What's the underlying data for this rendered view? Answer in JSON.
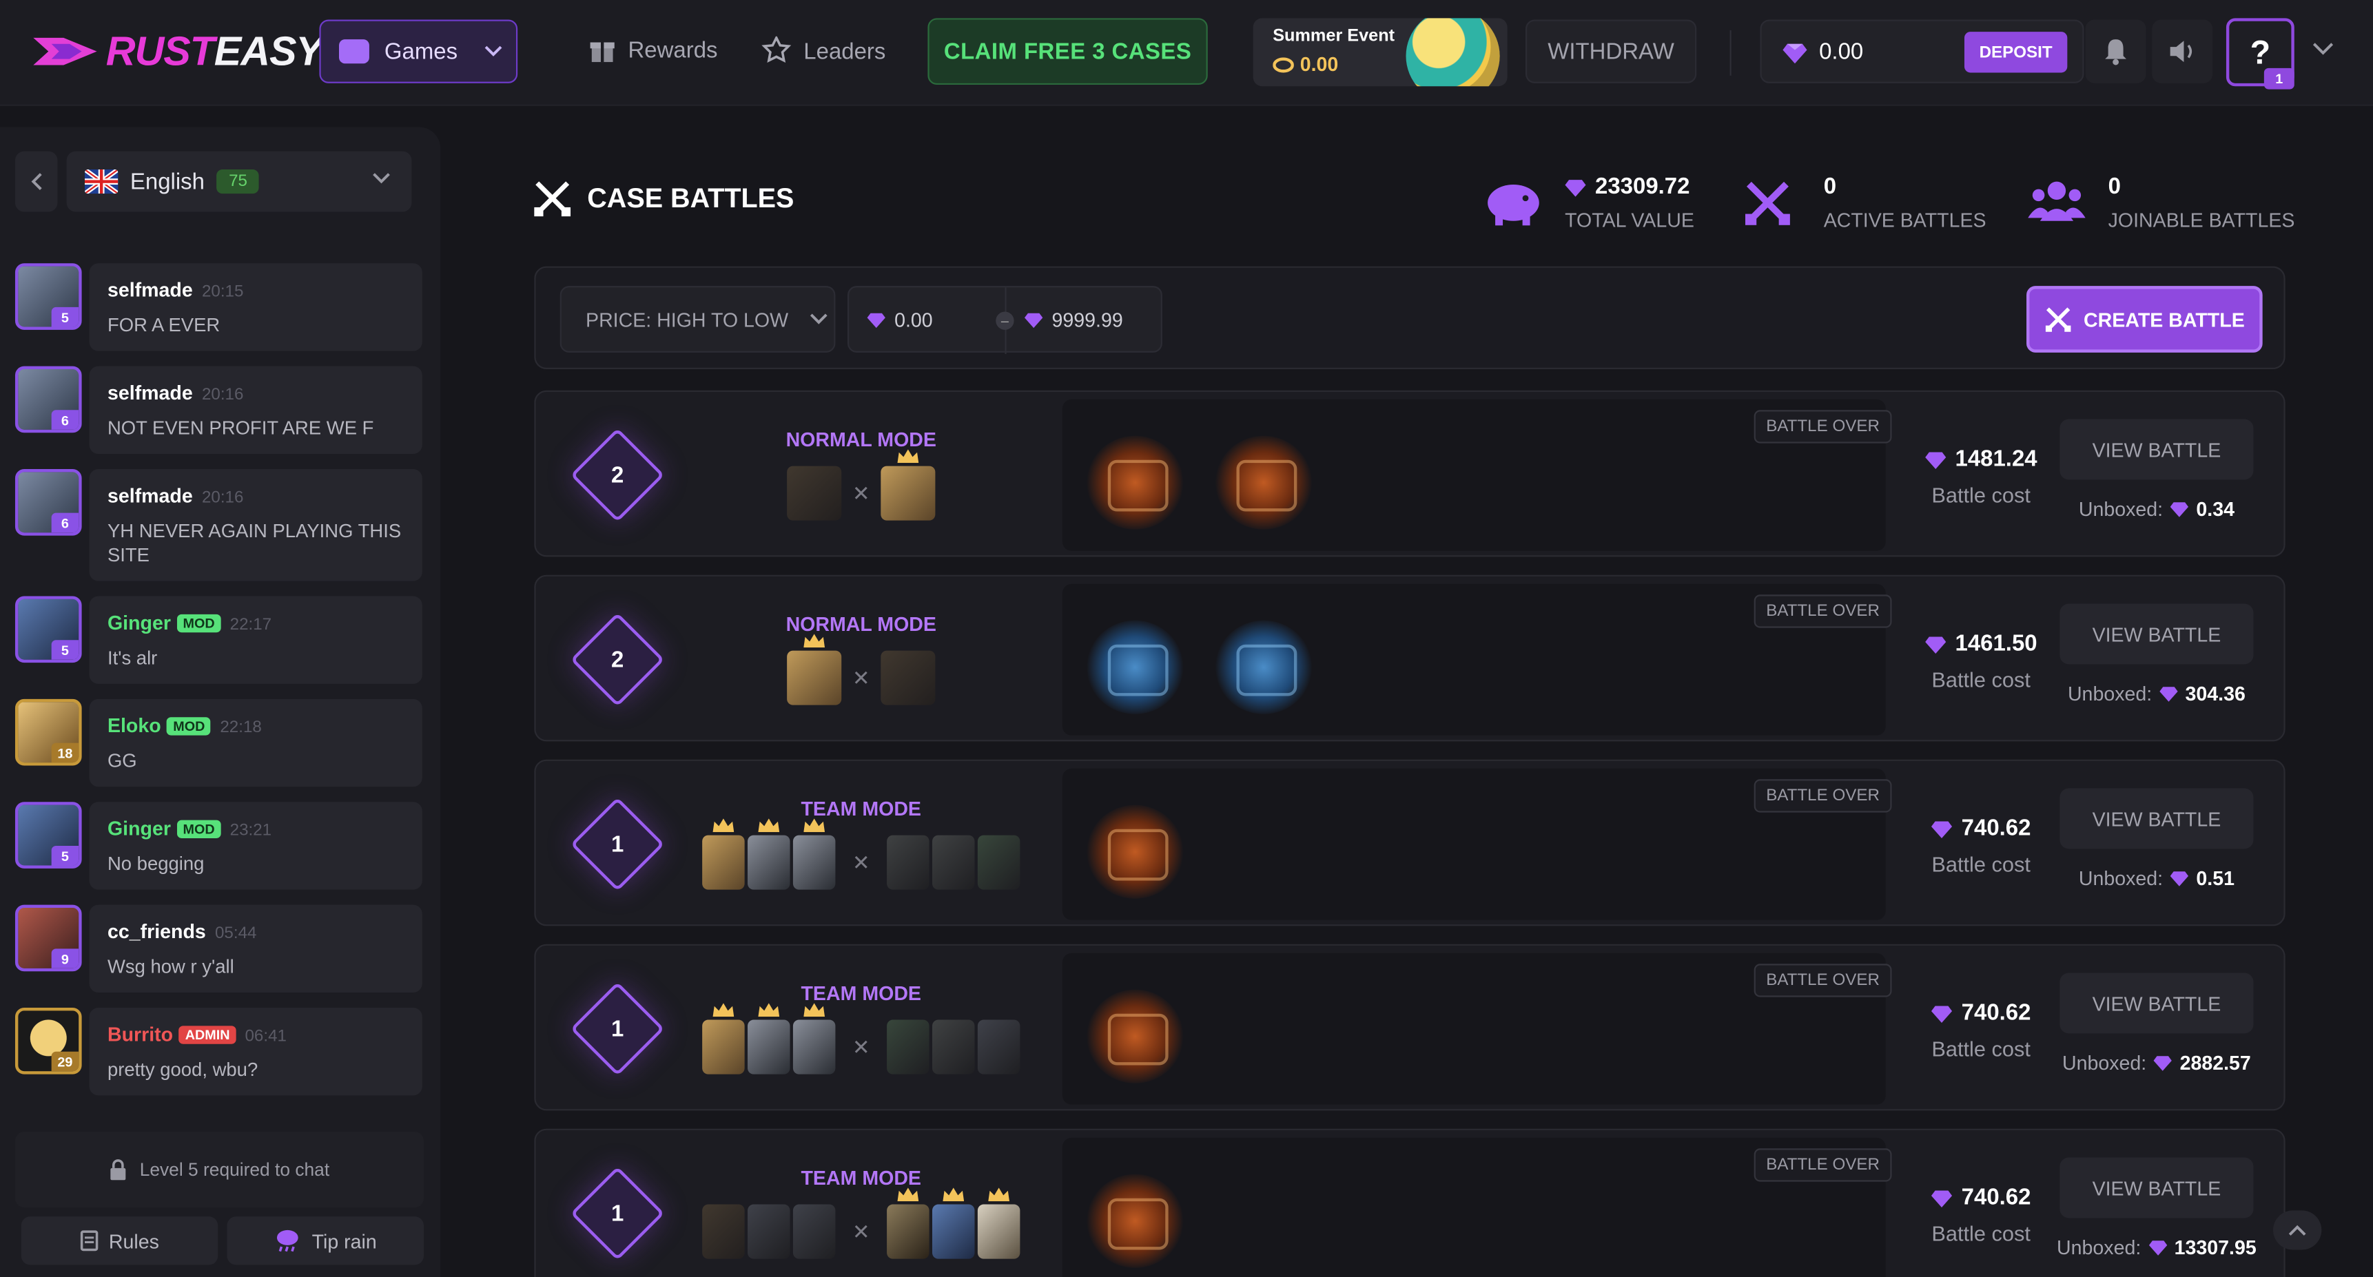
{
  "brand": {
    "part1": "RUST",
    "part2": "EASY"
  },
  "nav": {
    "games": "Games",
    "rewards": "Rewards",
    "leaders": "Leaders",
    "claim": "CLAIM FREE 3 CASES",
    "event_title": "Summer Event",
    "event_value": "0.00",
    "withdraw": "WITHDRAW",
    "balance": "0.00",
    "deposit": "DEPOSIT",
    "help": "?",
    "help_badge": "1"
  },
  "sidebar": {
    "language": "English",
    "online": "75",
    "messages": [
      {
        "user": "selfmade",
        "time": "20:15",
        "text": "FOR A EVER",
        "level": "5",
        "role": ""
      },
      {
        "user": "selfmade",
        "time": "20:16",
        "text": "NOT EVEN PROFIT ARE WE F",
        "level": "6",
        "role": ""
      },
      {
        "user": "selfmade",
        "time": "20:16",
        "text": "YH NEVER AGAIN PLAYING THIS SITE",
        "level": "6",
        "role": ""
      },
      {
        "user": "Ginger",
        "time": "22:17",
        "text": "It's alr",
        "level": "5",
        "role": "MOD"
      },
      {
        "user": "Eloko",
        "time": "22:18",
        "text": "GG",
        "level": "18",
        "role": "MOD"
      },
      {
        "user": "Ginger",
        "time": "23:21",
        "text": "No begging",
        "level": "5",
        "role": "MOD"
      },
      {
        "user": "cc_friends",
        "time": "05:44",
        "text": "Wsg how r y'all",
        "level": "9",
        "role": ""
      },
      {
        "user": "Burrito",
        "time": "06:41",
        "text": "pretty good, wbu?",
        "level": "29",
        "role": "ADMIN"
      }
    ],
    "chat_lock": "Level 5 required to chat",
    "rules": "Rules",
    "tip_rain": "Tip rain"
  },
  "main": {
    "title": "CASE BATTLES",
    "stats": [
      {
        "value": "23309.72",
        "label": "TOTAL VALUE"
      },
      {
        "value": "0",
        "label": "ACTIVE BATTLES"
      },
      {
        "value": "0",
        "label": "JOINABLE BATTLES"
      }
    ],
    "sort": "PRICE: HIGH TO LOW",
    "price_min": "0.00",
    "price_max": "9999.99",
    "create": "CREATE BATTLE",
    "battle_over": "BATTLE OVER",
    "view": "VIEW BATTLE",
    "cost_label": "Battle cost",
    "unboxed_label": "Unboxed:",
    "battles": [
      {
        "round": "2",
        "mode": "NORMAL MODE",
        "cost": "1481.24",
        "unboxed": "0.34",
        "case_style": "fire",
        "cases": 2
      },
      {
        "round": "2",
        "mode": "NORMAL MODE",
        "cost": "1461.50",
        "unboxed": "304.36",
        "case_style": "ice",
        "cases": 2
      },
      {
        "round": "1",
        "mode": "TEAM MODE",
        "cost": "740.62",
        "unboxed": "0.51",
        "case_style": "fire",
        "cases": 1
      },
      {
        "round": "1",
        "mode": "TEAM MODE",
        "cost": "740.62",
        "unboxed": "2882.57",
        "case_style": "fire",
        "cases": 1
      },
      {
        "round": "1",
        "mode": "TEAM MODE",
        "cost": "740.62",
        "unboxed": "13307.95",
        "case_style": "fire",
        "cases": 1
      }
    ]
  },
  "colors": {
    "accent": "#8f49df",
    "mod": "#57e27a",
    "admin": "#e24545"
  }
}
